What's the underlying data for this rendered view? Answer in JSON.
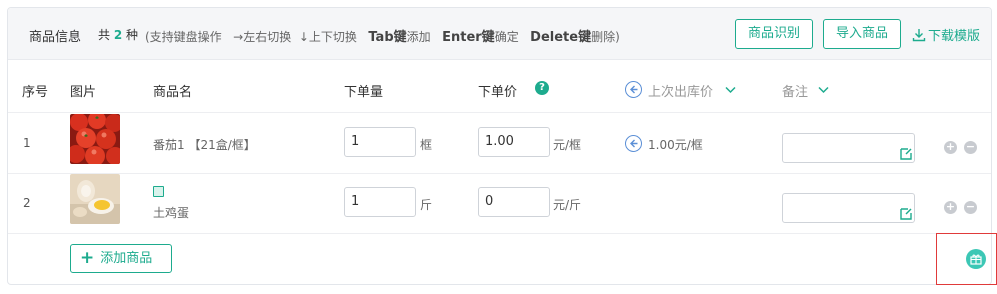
{
  "toolbar": {
    "title": "商品信息",
    "count_prefix": "共",
    "count": "2",
    "count_suffix": "种",
    "hint_open": "(支持键盘操作",
    "hint_lr": "→左右切换",
    "hint_ud": "↓上下切换",
    "hint_tab_key": "Tab键",
    "hint_tab_action": "添加",
    "hint_enter_key": "Enter键",
    "hint_enter_action": "确定",
    "hint_delete_key": "Delete键",
    "hint_delete_action": "删除)",
    "recognize_label": "商品识别",
    "import_label": "导入商品",
    "download_label": "下载模版"
  },
  "columns": {
    "index": "序号",
    "image": "图片",
    "name": "商品名",
    "qty": "下单量",
    "price": "下单价",
    "last_price": "上次出库价",
    "remark": "备注"
  },
  "rows": [
    {
      "index": "1",
      "image_icon": "tomato-photo",
      "name": "番茄1 【21盒/框】",
      "qty": "1",
      "qty_unit": "框",
      "price": "1.00",
      "price_unit": "元/框",
      "last_price": "1.00元/框",
      "remark": ""
    },
    {
      "index": "2",
      "image_icon": "egg-photo",
      "name": "土鸡蛋",
      "qty": "1",
      "qty_unit": "斤",
      "price": "0",
      "price_unit": "元/斤",
      "last_price": "",
      "remark": ""
    }
  ],
  "footer": {
    "add_label": "添加商品"
  },
  "colors": {
    "accent": "#1dab8e",
    "highlight_box": "#e03a3a",
    "link_blue": "#5b8fd6"
  }
}
